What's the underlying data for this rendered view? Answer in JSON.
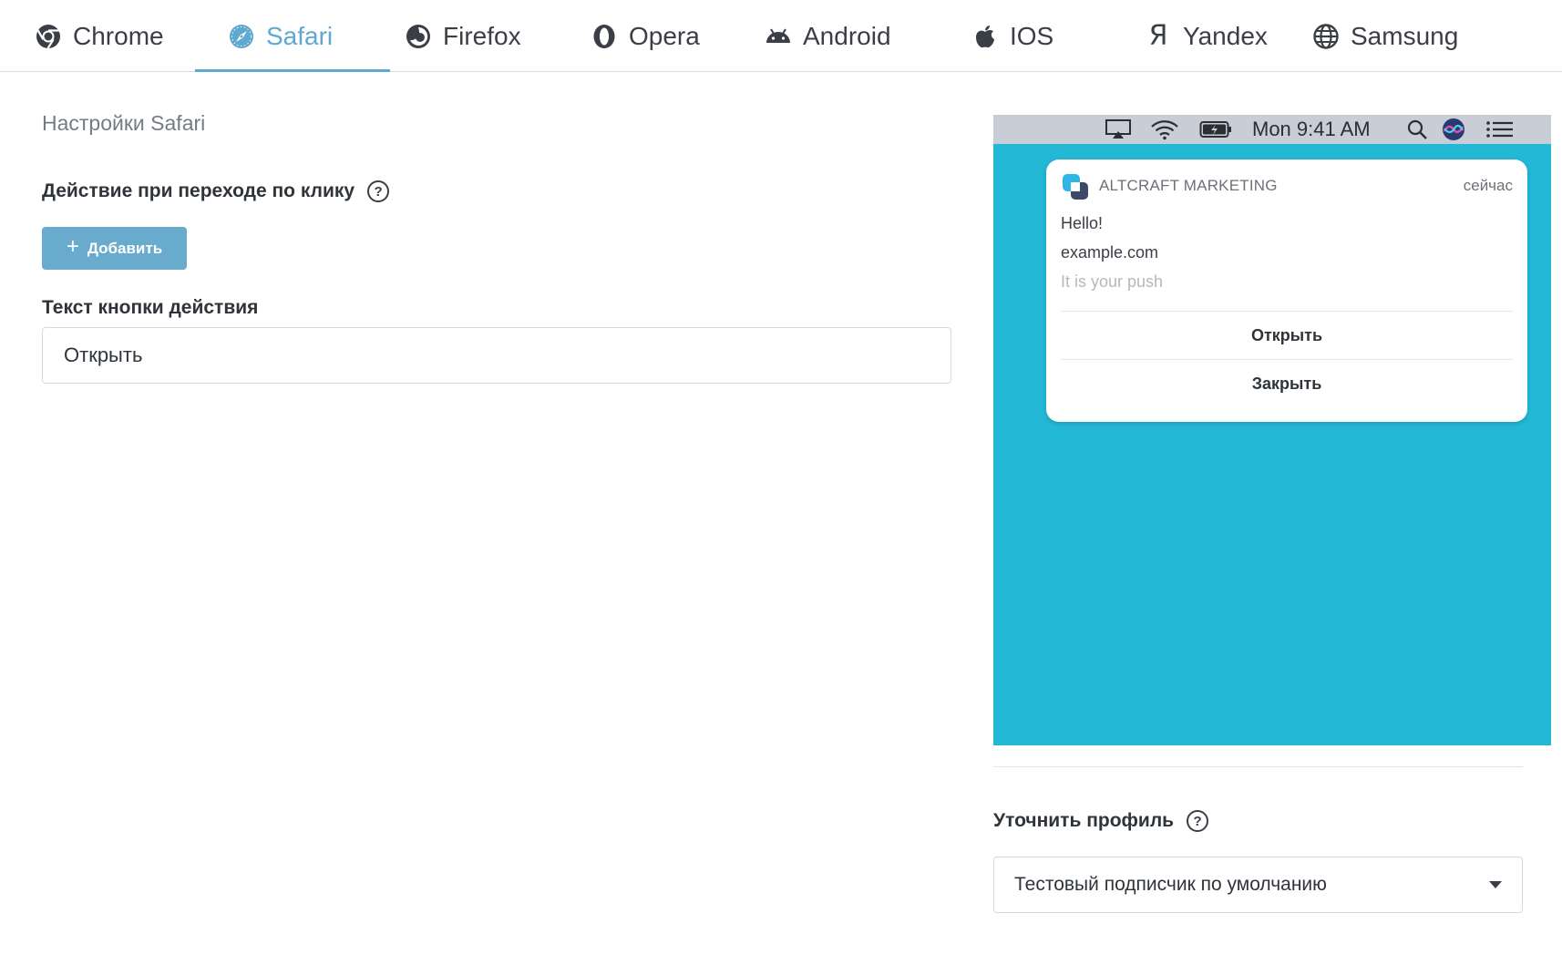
{
  "tabs": [
    {
      "label": "Chrome",
      "icon": "chrome-icon"
    },
    {
      "label": "Safari",
      "icon": "safari-icon",
      "active": true
    },
    {
      "label": "Firefox",
      "icon": "firefox-icon"
    },
    {
      "label": "Opera",
      "icon": "opera-icon"
    },
    {
      "label": "Android",
      "icon": "android-icon"
    },
    {
      "label": "IOS",
      "icon": "apple-icon"
    },
    {
      "label": "Yandex",
      "icon": "yandex-icon"
    },
    {
      "label": "Samsung",
      "icon": "globe-icon"
    }
  ],
  "settings": {
    "title": "Настройки Safari",
    "click_action_label": "Действие при переходе по клику",
    "add_button": "Добавить",
    "button_text_label": "Текст кнопки действия",
    "button_text_value": "Открыть"
  },
  "preview": {
    "menubar_time": "Mon 9:41 AM",
    "notification": {
      "app_name": "ALTCRAFT MARKETING",
      "time": "сейчас",
      "title": "Hello!",
      "site": "example.com",
      "body": "It is your push",
      "actions": [
        "Открыть",
        "Закрыть"
      ]
    }
  },
  "profile": {
    "label": "Уточнить профиль",
    "selected": "Тестовый подписчик по умолчанию"
  },
  "colors": {
    "accent": "#5fa8cf",
    "button": "#69abcd",
    "preview_bg": "#22b8d6"
  }
}
